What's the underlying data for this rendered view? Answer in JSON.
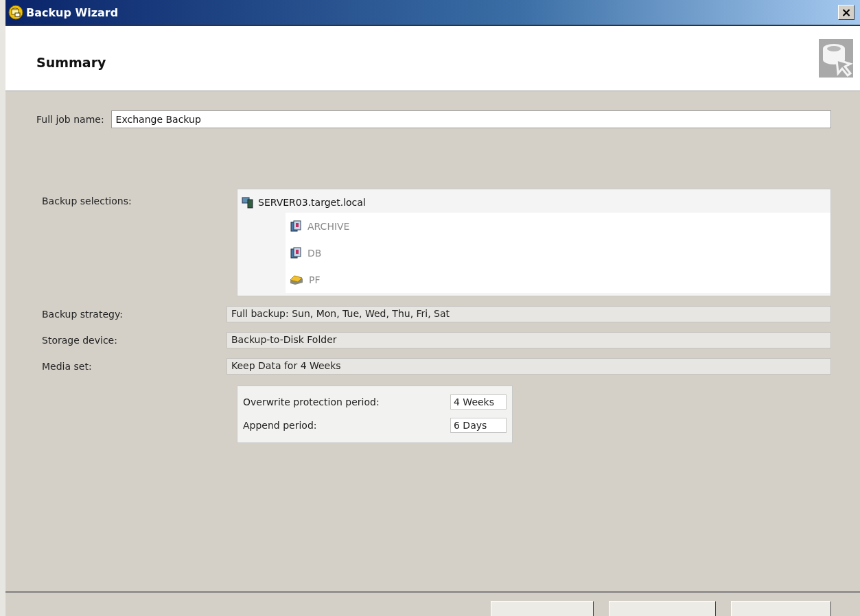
{
  "window": {
    "title": "Backup Wizard",
    "close": "×"
  },
  "header": {
    "title": "Summary"
  },
  "job_name": {
    "label": "Full job name:",
    "value": "Exchange Backup"
  },
  "selections": {
    "label": "Backup selections:",
    "tree": [
      {
        "label": "SERVER03.target.local",
        "kind": "server",
        "disabled": false,
        "children": [
          {
            "label": "ARCHIVE",
            "kind": "database",
            "disabled": true
          },
          {
            "label": "DB",
            "kind": "database",
            "disabled": true
          },
          {
            "label": "PF",
            "kind": "folder",
            "disabled": true
          }
        ]
      }
    ]
  },
  "details": [
    {
      "label": "Backup strategy:",
      "value": "Full backup: Sun, Mon, Tue, Wed, Thu, Fri, Sat"
    },
    {
      "label": "Storage device:",
      "value": "Backup-to-Disk Folder"
    },
    {
      "label": "Media set:",
      "value": "Keep Data for 4 Weeks"
    }
  ],
  "media_periods": [
    {
      "label": "Overwrite protection period:",
      "value": "4 Weeks"
    },
    {
      "label": "Append period:",
      "value": "6 Days"
    }
  ],
  "buttons": [
    {
      "kind": "back"
    },
    {
      "kind": "submit"
    },
    {
      "kind": "cancel"
    }
  ]
}
